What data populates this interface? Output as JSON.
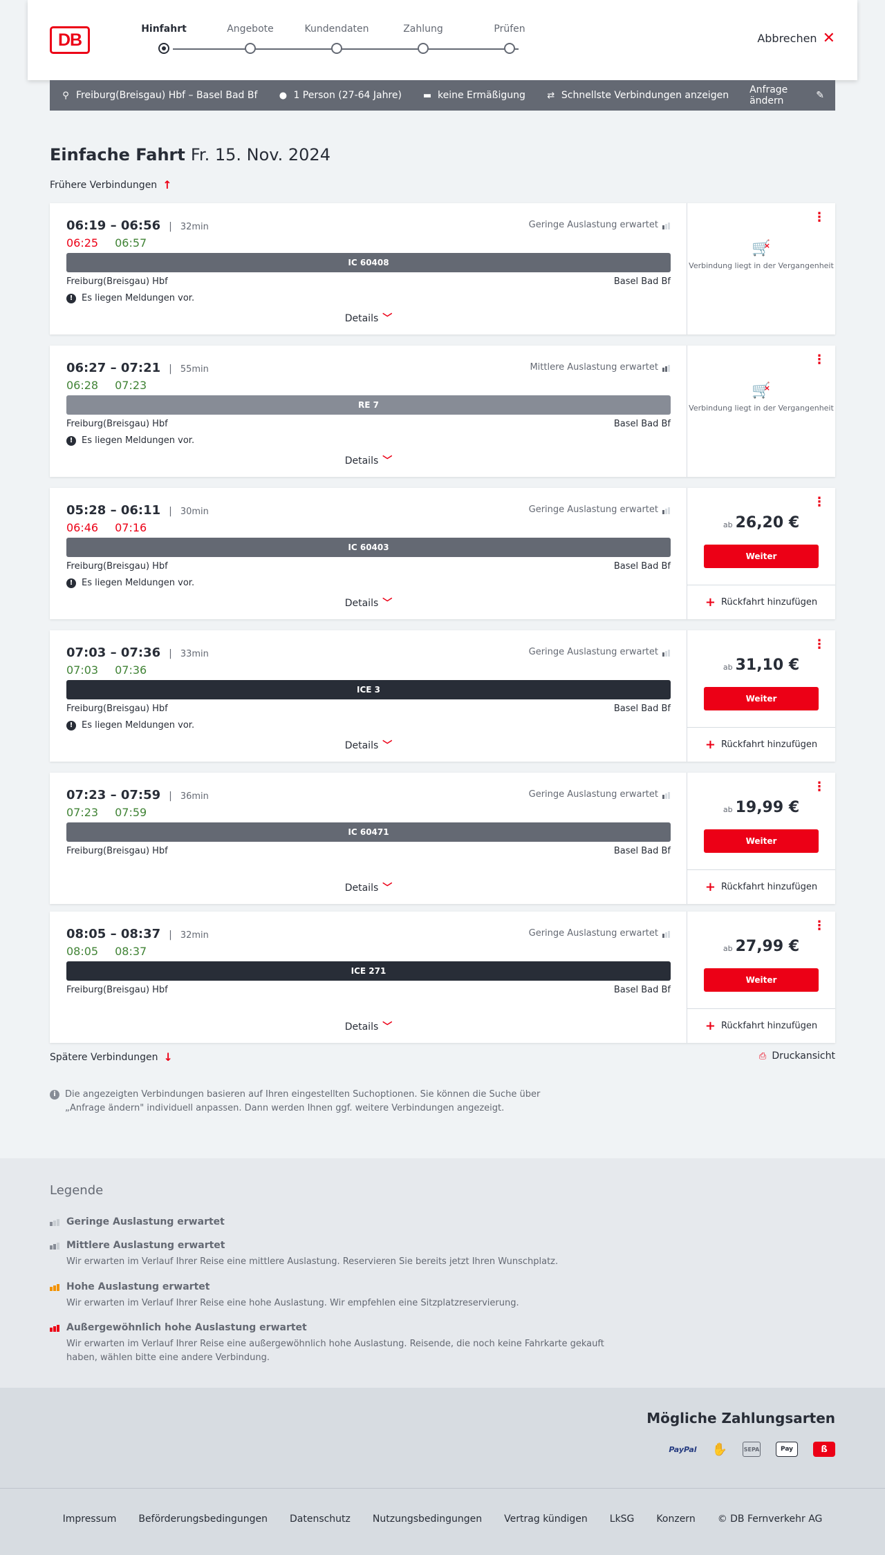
{
  "header": {
    "logo": "DB",
    "steps": [
      "Hinfahrt",
      "Angebote",
      "Kundendaten",
      "Zahlung",
      "Prüfen"
    ],
    "active_step": "Hinfahrt",
    "cancel_label": "Abbrechen"
  },
  "search": {
    "route": "Freiburg(Breisgau) Hbf – Basel Bad Bf",
    "passengers": "1 Person (27-64 Jahre)",
    "discount": "keine Ermäßigung",
    "fastest": "Schnellste Verbindungen anzeigen",
    "edit": "Anfrage ändern"
  },
  "page": {
    "title": "Einfache Fahrt",
    "date": "Fr. 15. Nov. 2024",
    "earlier": "Frühere Verbindungen",
    "later": "Spätere Verbindungen",
    "print": "Druckansicht",
    "info": "Die angezeigten Verbindungen basieren auf Ihren eingestellten Suchoptionen. Sie können die Suche über „Anfrage ändern\" individuell anpassen. Dann werden Ihnen ggf. weitere Verbindungen angezeigt."
  },
  "labels": {
    "details": "Details",
    "past": "Verbindung liegt in der Vergangenheit",
    "ab": "ab",
    "weiter": "Weiter",
    "return": "Rückfahrt hinzufügen",
    "notice": "Es liegen Meldungen vor.",
    "from": "Freiburg(Breisgau) Hbf",
    "to": "Basel Bad Bf"
  },
  "colors": {
    "accent": "#ec0016",
    "delay": "#ec0016",
    "ontime": "#408335",
    "ic_bar": "#646973",
    "re_bar": "#878c96",
    "ice_bar": "#282d37"
  },
  "connections": [
    {
      "times": "06:19 – 06:56",
      "duration": "32min",
      "rt_dep": "06:25",
      "rt_arr": "06:57",
      "rt_dep_status": "late",
      "rt_arr_status": "ok",
      "load": "Geringe Auslastung erwartet",
      "load_level": 1,
      "train": "IC 60408",
      "train_type": "ic",
      "notice": true,
      "past": true,
      "price": ""
    },
    {
      "times": "06:27 – 07:21",
      "duration": "55min",
      "rt_dep": "06:28",
      "rt_arr": "07:23",
      "rt_dep_status": "ok",
      "rt_arr_status": "ok",
      "load": "Mittlere Auslastung erwartet",
      "load_level": 2,
      "train": "RE 7",
      "train_type": "re",
      "notice": true,
      "past": true,
      "price": ""
    },
    {
      "times": "05:28 – 06:11",
      "duration": "30min",
      "rt_dep": "06:46",
      "rt_arr": "07:16",
      "rt_dep_status": "late",
      "rt_arr_status": "late",
      "load": "Geringe Auslastung erwartet",
      "load_level": 1,
      "train": "IC 60403",
      "train_type": "ic",
      "notice": true,
      "past": false,
      "price": "26,20 €"
    },
    {
      "times": "07:03 – 07:36",
      "duration": "33min",
      "rt_dep": "07:03",
      "rt_arr": "07:36",
      "rt_dep_status": "ok",
      "rt_arr_status": "ok",
      "load": "Geringe Auslastung erwartet",
      "load_level": 1,
      "train": "ICE 3",
      "train_type": "ice",
      "notice": true,
      "past": false,
      "price": "31,10 €"
    },
    {
      "times": "07:23 – 07:59",
      "duration": "36min",
      "rt_dep": "07:23",
      "rt_arr": "07:59",
      "rt_dep_status": "ok",
      "rt_arr_status": "ok",
      "load": "Geringe Auslastung erwartet",
      "load_level": 1,
      "train": "IC 60471",
      "train_type": "ic",
      "notice": false,
      "past": false,
      "price": "19,99 €"
    },
    {
      "times": "08:05 – 08:37",
      "duration": "32min",
      "rt_dep": "08:05",
      "rt_arr": "08:37",
      "rt_dep_status": "ok",
      "rt_arr_status": "ok",
      "load": "Geringe Auslastung erwartet",
      "load_level": 1,
      "train": "ICE 271",
      "train_type": "ice",
      "notice": false,
      "past": false,
      "price": "27,99 €"
    }
  ],
  "legend": {
    "title": "Legende",
    "items": [
      {
        "title": "Geringe Auslastung erwartet",
        "desc": "",
        "color": "#878c96",
        "level": 1
      },
      {
        "title": "Mittlere Auslastung erwartet",
        "desc": "Wir erwarten im Verlauf Ihrer Reise eine mittlere Auslastung. Reservieren Sie bereits jetzt Ihren Wunschplatz.",
        "color": "#878c96",
        "level": 2
      },
      {
        "title": "Hohe Auslastung erwartet",
        "desc": "Wir erwarten im Verlauf Ihrer Reise eine hohe Auslastung. Wir empfehlen eine Sitzplatzreservierung.",
        "color": "#f39200",
        "level": 3
      },
      {
        "title": "Außergewöhnlich hohe Auslastung erwartet",
        "desc": "Wir erwarten im Verlauf Ihrer Reise eine außergewöhnlich hohe Auslastung. Reisende, die noch keine Fahrkarte gekauft haben, wählen bitte eine andere Verbindung.",
        "color": "#ec0016",
        "level": 4
      }
    ]
  },
  "payment": {
    "title": "Mögliche Zahlungsarten",
    "methods": [
      "PayPal",
      "Kreditkarte",
      "SEPA-Lastschrift",
      "Apple Pay",
      "DB Bonus"
    ]
  },
  "footer": {
    "links": [
      "Impressum",
      "Beförderungsbedingungen",
      "Datenschutz",
      "Nutzungsbedingungen",
      "Vertrag kündigen",
      "LkSG",
      "Konzern",
      "© DB Fernverkehr AG"
    ]
  }
}
